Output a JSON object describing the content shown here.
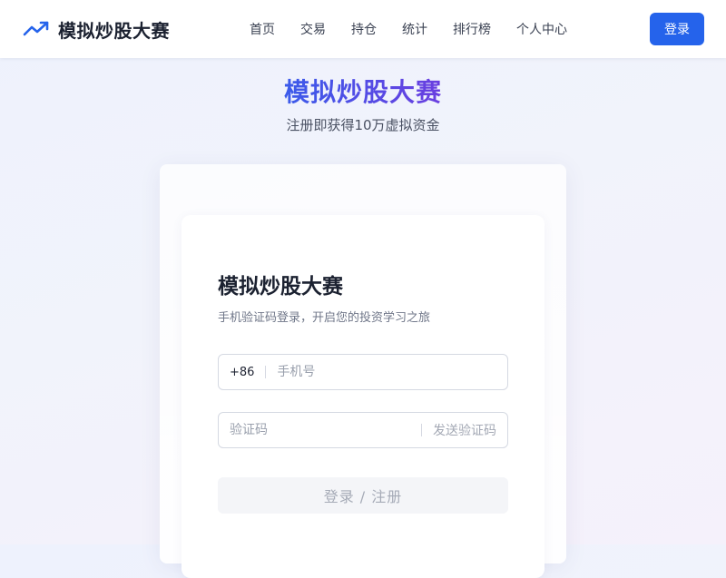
{
  "header": {
    "brand_icon": "trending-up-icon",
    "brand_name": "模拟炒股大赛",
    "nav": [
      "首页",
      "交易",
      "持仓",
      "统计",
      "排行榜",
      "个人中心"
    ],
    "login_label": "登录"
  },
  "hero": {
    "title": "模拟炒股大赛",
    "subtitle": "注册即获得10万虚拟资金"
  },
  "login_card": {
    "title": "模拟炒股大赛",
    "subtitle": "手机验证码登录，开启您的投资学习之旅",
    "phone_prefix": "+86",
    "phone_placeholder": "手机号",
    "code_placeholder": "验证码",
    "send_code_label": "发送验证码",
    "submit_label": "登录 / 注册"
  },
  "colors": {
    "accent": "#2563eb",
    "title_gradient_start": "#3b5bea",
    "title_gradient_end": "#6a3ee0"
  }
}
